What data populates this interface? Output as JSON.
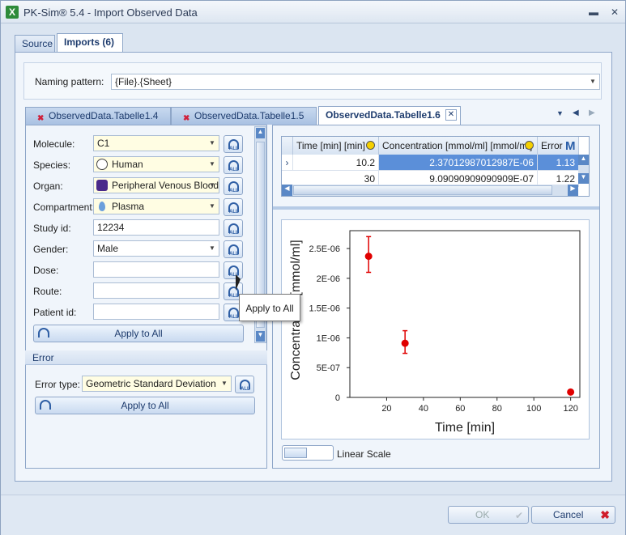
{
  "window": {
    "title": "PK-Sim® 5.4 - Import Observed Data",
    "app_icon": "X"
  },
  "top_tabs": [
    {
      "label": "Source"
    },
    {
      "label": "Imports (6)"
    }
  ],
  "naming": {
    "label": "Naming pattern:",
    "value": "{File}.{Sheet}"
  },
  "data_tabs": [
    {
      "label": "ObservedData.Tabelle1.4"
    },
    {
      "label": "ObservedData.Tabelle1.5"
    },
    {
      "label": "ObservedData.Tabelle1.6"
    }
  ],
  "meta": {
    "molecule": {
      "label": "Molecule:",
      "value": "C1"
    },
    "species": {
      "label": "Species:",
      "value": "Human"
    },
    "organ": {
      "label": "Organ:",
      "value": "Peripheral Venous Blood"
    },
    "compartment": {
      "label": "Compartment:",
      "value": "Plasma"
    },
    "study": {
      "label": "Study id:",
      "value": "12234"
    },
    "gender": {
      "label": "Gender:",
      "value": "Male"
    },
    "dose": {
      "label": "Dose:",
      "value": ""
    },
    "route": {
      "label": "Route:",
      "value": ""
    },
    "patient": {
      "label": "Patient id:",
      "value": ""
    },
    "apply_all": "Apply to All",
    "all_icon_text": "ALL"
  },
  "tooltip": "Apply to All",
  "error": {
    "header": "Error",
    "type_label": "Error type:",
    "type_value": "Geometric Standard Deviation",
    "apply_all": "Apply to All"
  },
  "grid": {
    "columns": [
      "Time [min] [min]",
      "Concentration [mmol/ml] [mmol/ml]",
      "Error"
    ],
    "rows": [
      [
        "10.2",
        "2.37012987012987E-06",
        "1.13"
      ],
      [
        "30",
        "9.09090909090909E-07",
        "1.22"
      ]
    ]
  },
  "chart_data": {
    "type": "scatter",
    "xlabel": "Time [min]",
    "ylabel": "Concentration [mmol/ml]",
    "xlim": [
      0,
      125
    ],
    "ylim": [
      0,
      2.8e-06
    ],
    "x_ticks": [
      "20",
      "40",
      "60",
      "80",
      "100",
      "120"
    ],
    "y_ticks": [
      "0",
      "5E-07",
      "1E-06",
      "1.5E-06",
      "2E-06",
      "2.5E-06"
    ],
    "series": [
      {
        "x": [
          10.2,
          30,
          120
        ],
        "y": [
          2.37012987e-06,
          9.09090909e-07,
          9e-08
        ],
        "error_low": [
          2.1e-06,
          7.4e-07,
          null
        ],
        "error_high": [
          2.7e-06,
          1.12e-06,
          null
        ],
        "color": "#e00000"
      }
    ]
  },
  "scale": {
    "label": "Linear Scale"
  },
  "buttons": {
    "ok": "OK",
    "cancel": "Cancel"
  }
}
